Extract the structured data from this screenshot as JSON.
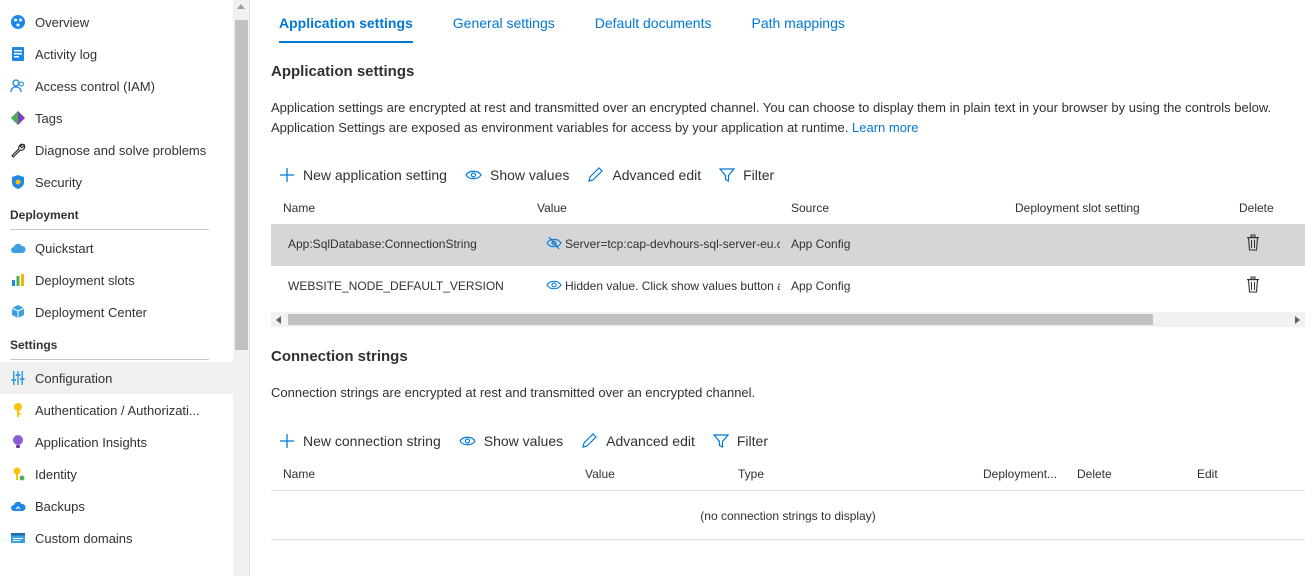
{
  "sidebar": {
    "group1": [
      {
        "label": "Overview",
        "icon": "globe-icon"
      },
      {
        "label": "Activity log",
        "icon": "log-icon"
      },
      {
        "label": "Access control (IAM)",
        "icon": "people-icon"
      },
      {
        "label": "Tags",
        "icon": "tag-icon"
      },
      {
        "label": "Diagnose and solve problems",
        "icon": "wrench-icon"
      },
      {
        "label": "Security",
        "icon": "shield-icon"
      }
    ],
    "section_deployment": "Deployment",
    "group2": [
      {
        "label": "Quickstart",
        "icon": "cloud-icon"
      },
      {
        "label": "Deployment slots",
        "icon": "chart-icon"
      },
      {
        "label": "Deployment Center",
        "icon": "cube-icon"
      }
    ],
    "section_settings": "Settings",
    "group3": [
      {
        "label": "Configuration",
        "icon": "sliders-icon"
      },
      {
        "label": "Authentication / Authorizati...",
        "icon": "key-icon"
      },
      {
        "label": "Application Insights",
        "icon": "bulb-icon"
      },
      {
        "label": "Identity",
        "icon": "key-identity-icon"
      },
      {
        "label": "Backups",
        "icon": "cloud-backup-icon"
      },
      {
        "label": "Custom domains",
        "icon": "domain-icon"
      }
    ]
  },
  "tabs": [
    "Application settings",
    "General settings",
    "Default documents",
    "Path mappings"
  ],
  "app_settings": {
    "title": "Application settings",
    "desc_text": "Application settings are encrypted at rest and transmitted over an encrypted channel. You can choose to display them in plain text in your browser by using the controls below. Application Settings are exposed as environment variables for access by your application at runtime.",
    "learn_more": "Learn more",
    "toolbar": {
      "new": "New application setting",
      "show": "Show values",
      "advanced": "Advanced edit",
      "filter": "Filter"
    },
    "columns": {
      "name": "Name",
      "value": "Value",
      "source": "Source",
      "slot": "Deployment slot setting",
      "delete": "Delete"
    },
    "rows": [
      {
        "name": "App:SqlDatabase:ConnectionString",
        "value": "Server=tcp:cap-devhours-sql-server-eu.c",
        "source": "App Config"
      },
      {
        "name": "WEBSITE_NODE_DEFAULT_VERSION",
        "value": "Hidden value. Click show values button a",
        "source": "App Config"
      }
    ]
  },
  "conn_strings": {
    "title": "Connection strings",
    "desc": "Connection strings are encrypted at rest and transmitted over an encrypted channel.",
    "toolbar": {
      "new": "New connection string",
      "show": "Show values",
      "advanced": "Advanced edit",
      "filter": "Filter"
    },
    "columns": {
      "name": "Name",
      "value": "Value",
      "type": "Type",
      "slot": "Deployment...",
      "delete": "Delete",
      "edit": "Edit"
    },
    "empty": "(no connection strings to display)"
  },
  "colors": {
    "accent": "#0078d4",
    "selected_row": "#d6d6d6"
  }
}
